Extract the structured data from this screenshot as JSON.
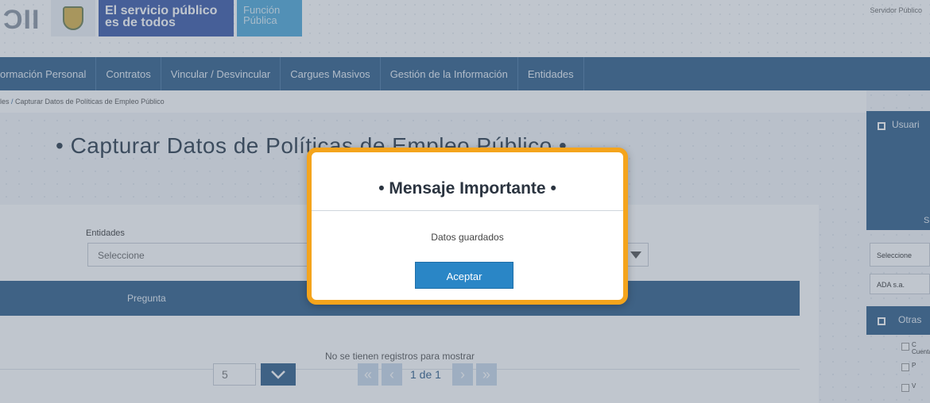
{
  "header": {
    "logo_text": "ƆII",
    "brand_line1": "El servicio público",
    "brand_line2": "es de todos",
    "funcion_line1": "Función",
    "funcion_line2": "Pública",
    "user_role": "Servidor Público"
  },
  "nav": {
    "items": [
      {
        "label": "ormación Personal"
      },
      {
        "label": "Contratos"
      },
      {
        "label": "Vincular / Desvincular"
      },
      {
        "label": "Cargues Masivos"
      },
      {
        "label": "Gestión de la Información"
      },
      {
        "label": "Entidades"
      }
    ]
  },
  "breadcrumb": {
    "first": "les",
    "separator": " / ",
    "current": "Capturar Datos de Políticas de Empleo Público"
  },
  "main": {
    "title": "• Capturar Datos de Políticas de Empleo Público •",
    "entity_label": "Entidades",
    "entity_select_value": "Seleccione",
    "table_header": "Pregunta",
    "empty_message": "No se tienen registros para mostrar",
    "page_size": "5",
    "page_indicator": "1 de 1"
  },
  "sidebar": {
    "user_title": "Usuari",
    "s_letter": "S",
    "select_value": "Seleccione",
    "entity_value": "ADA s.a.",
    "other_title": "Otras",
    "list": [
      {
        "label": "C Cuenta"
      },
      {
        "label": "P"
      },
      {
        "label": "V"
      }
    ]
  },
  "modal": {
    "title": "• Mensaje Importante •",
    "message": "Datos guardados",
    "accept_label": "Aceptar"
  }
}
